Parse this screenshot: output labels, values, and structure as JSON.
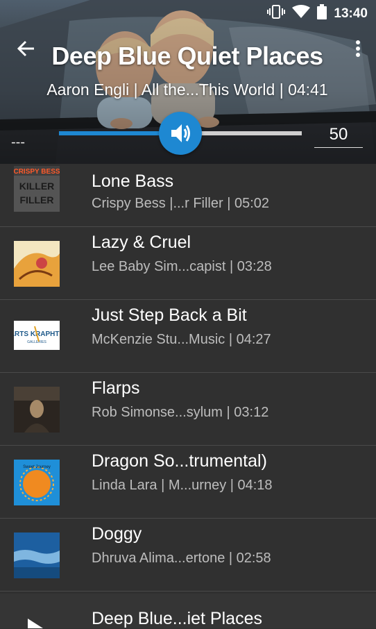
{
  "status_bar": {
    "time": "13:40",
    "icons": [
      "vibrate-icon",
      "wifi-icon",
      "battery-icon"
    ]
  },
  "header": {
    "title": "Deep Blue Quiet Places",
    "subtitle": "Aaron Engli | All the...This World | 04:41",
    "elapsed": "---",
    "volume": 50,
    "volume_display": "50",
    "back_icon": "back-arrow-icon",
    "menu_icon": "more-vert-icon"
  },
  "colors": {
    "accent": "#1e88d2",
    "list_background": "#303030",
    "divider": "#4a4a4a",
    "secondary_text": "#bdbdbd"
  },
  "tracks": [
    {
      "title": "Lone Bass",
      "subtitle": "Crispy Bess |...r Filler | 05:02",
      "art_text_top": "CRISPY BESS",
      "art_text_main": "KILLER FILLER"
    },
    {
      "title": "Lazy & Cruel",
      "subtitle": "Lee Baby Sim...capist | 03:28"
    },
    {
      "title": "Just Step Back a Bit",
      "subtitle": "McKenzie Stu...Music | 04:27",
      "art_text_main": "ARTS & KRAPHTS",
      "art_text_sub": "GALLERIES"
    },
    {
      "title": "Flarps",
      "subtitle": "Rob Simonse...sylum | 03:12"
    },
    {
      "title": "Dragon So...trumental)",
      "subtitle": "Linda Lara | M...urney | 04:18"
    },
    {
      "title": "Doggy",
      "subtitle": "Dhruva Alima...ertone | 02:58"
    }
  ],
  "now_playing": {
    "title": "Deep Blue...iet Places",
    "icon": "play-icon"
  }
}
